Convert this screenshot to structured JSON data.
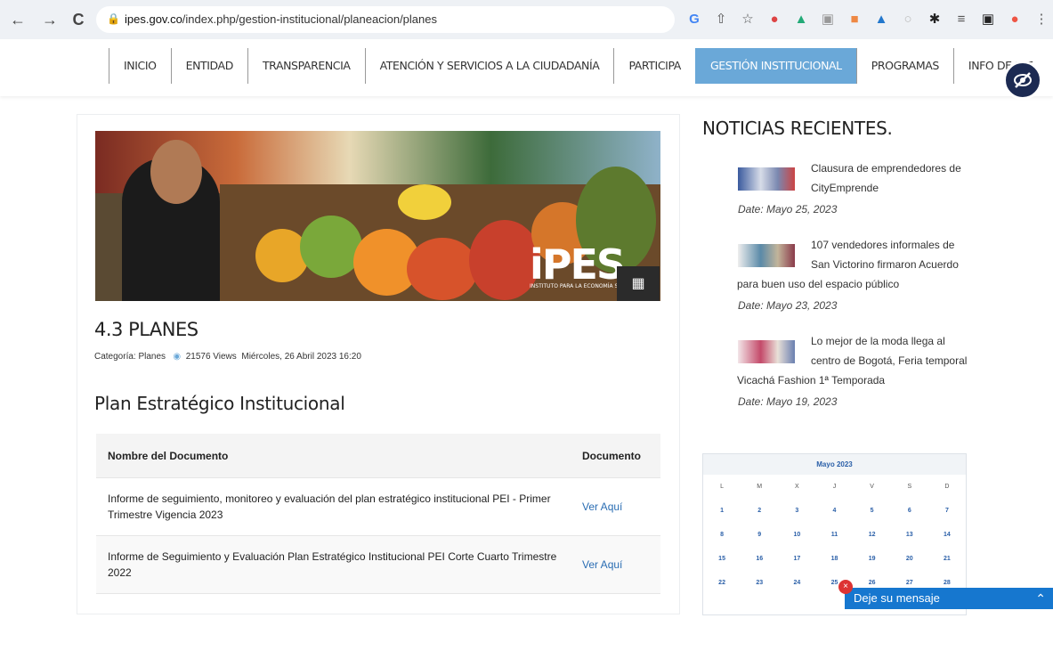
{
  "browser": {
    "back": "←",
    "forward": "→",
    "reload": "C",
    "url_host": "ipes.gov.co",
    "url_path": "/index.php/gestion-institucional/planeacion/planes",
    "icons": [
      "translate-icon",
      "share-icon",
      "star-icon",
      "extension-icon",
      "extension-icon",
      "camera-icon",
      "extension-icon",
      "drive-icon",
      "extension-icon",
      "puzzle-icon",
      "playlist-icon",
      "sidepanel-icon",
      "profile-icon",
      "menu-icon"
    ]
  },
  "nav": {
    "items": [
      {
        "label": "INICIO"
      },
      {
        "label": "ENTIDAD"
      },
      {
        "label": "TRANSPARENCIA"
      },
      {
        "label": "ATENCIÓN Y SERVICIOS A LA CIUDADANÍA"
      },
      {
        "label": "PARTICIPA"
      },
      {
        "label": "GESTIÓN INSTITUCIONAL",
        "active": true
      },
      {
        "label": "PROGRAMAS"
      },
      {
        "label": "INFO DE INT"
      }
    ],
    "accent_color": "#6aa8d8"
  },
  "article": {
    "logo_text": "iPES",
    "logo_tagline": "INSTITUTO PARA LA ECONOMÍA SOCIAL",
    "title": "4.3 PLANES",
    "category": "Categoría: Planes",
    "views": "21576 Views",
    "date": "Miércoles, 26 Abril 2023 16:20",
    "section_title": "Plan Estratégico Institucional",
    "table": {
      "headers": [
        "Nombre del Documento",
        "Documento"
      ],
      "rows": [
        {
          "name": "Informe de seguimiento, monitoreo y evaluación del plan estratégico institucional PEI - Primer Trimestre Vigencia 2023",
          "link": "Ver Aquí"
        },
        {
          "name": "Informe de Seguimiento y Evaluación Plan Estratégico Institucional PEI Corte Cuarto Trimestre 2022",
          "link": "Ver Aquí"
        }
      ]
    }
  },
  "sidebar": {
    "heading": "NOTICIAS RECIENTES.",
    "news": [
      {
        "title_line1": "Clausura de emprendedores de",
        "title_line2": "CityEmprende",
        "date": "Date: Mayo 25, 2023"
      },
      {
        "title_line1": "107 vendedores informales de",
        "title_line2": "San Victorino firmaron Acuerdo",
        "title_line3": "para buen uso del espacio público",
        "date": "Date: Mayo 23, 2023"
      },
      {
        "title_line1": "Lo mejor de la moda llega al",
        "title_line2": "centro de Bogotá, Feria temporal",
        "title_line3": "Vicachá Fashion 1ª Temporada",
        "date": "Date: Mayo 19, 2023"
      }
    ],
    "calendar": {
      "month": "Mayo 2023",
      "weekdays": [
        "L",
        "M",
        "X",
        "J",
        "V",
        "S",
        "D"
      ],
      "weeks": [
        [
          "1",
          "2",
          "3",
          "4",
          "5",
          "6",
          "7"
        ],
        [
          "8",
          "9",
          "10",
          "11",
          "12",
          "13",
          "14"
        ],
        [
          "15",
          "16",
          "17",
          "18",
          "19",
          "20",
          "21"
        ],
        [
          "22",
          "23",
          "24",
          "25",
          "26",
          "27",
          "28"
        ]
      ]
    }
  },
  "chat": {
    "label": "Deje su mensaje",
    "color": "#1677cf"
  }
}
